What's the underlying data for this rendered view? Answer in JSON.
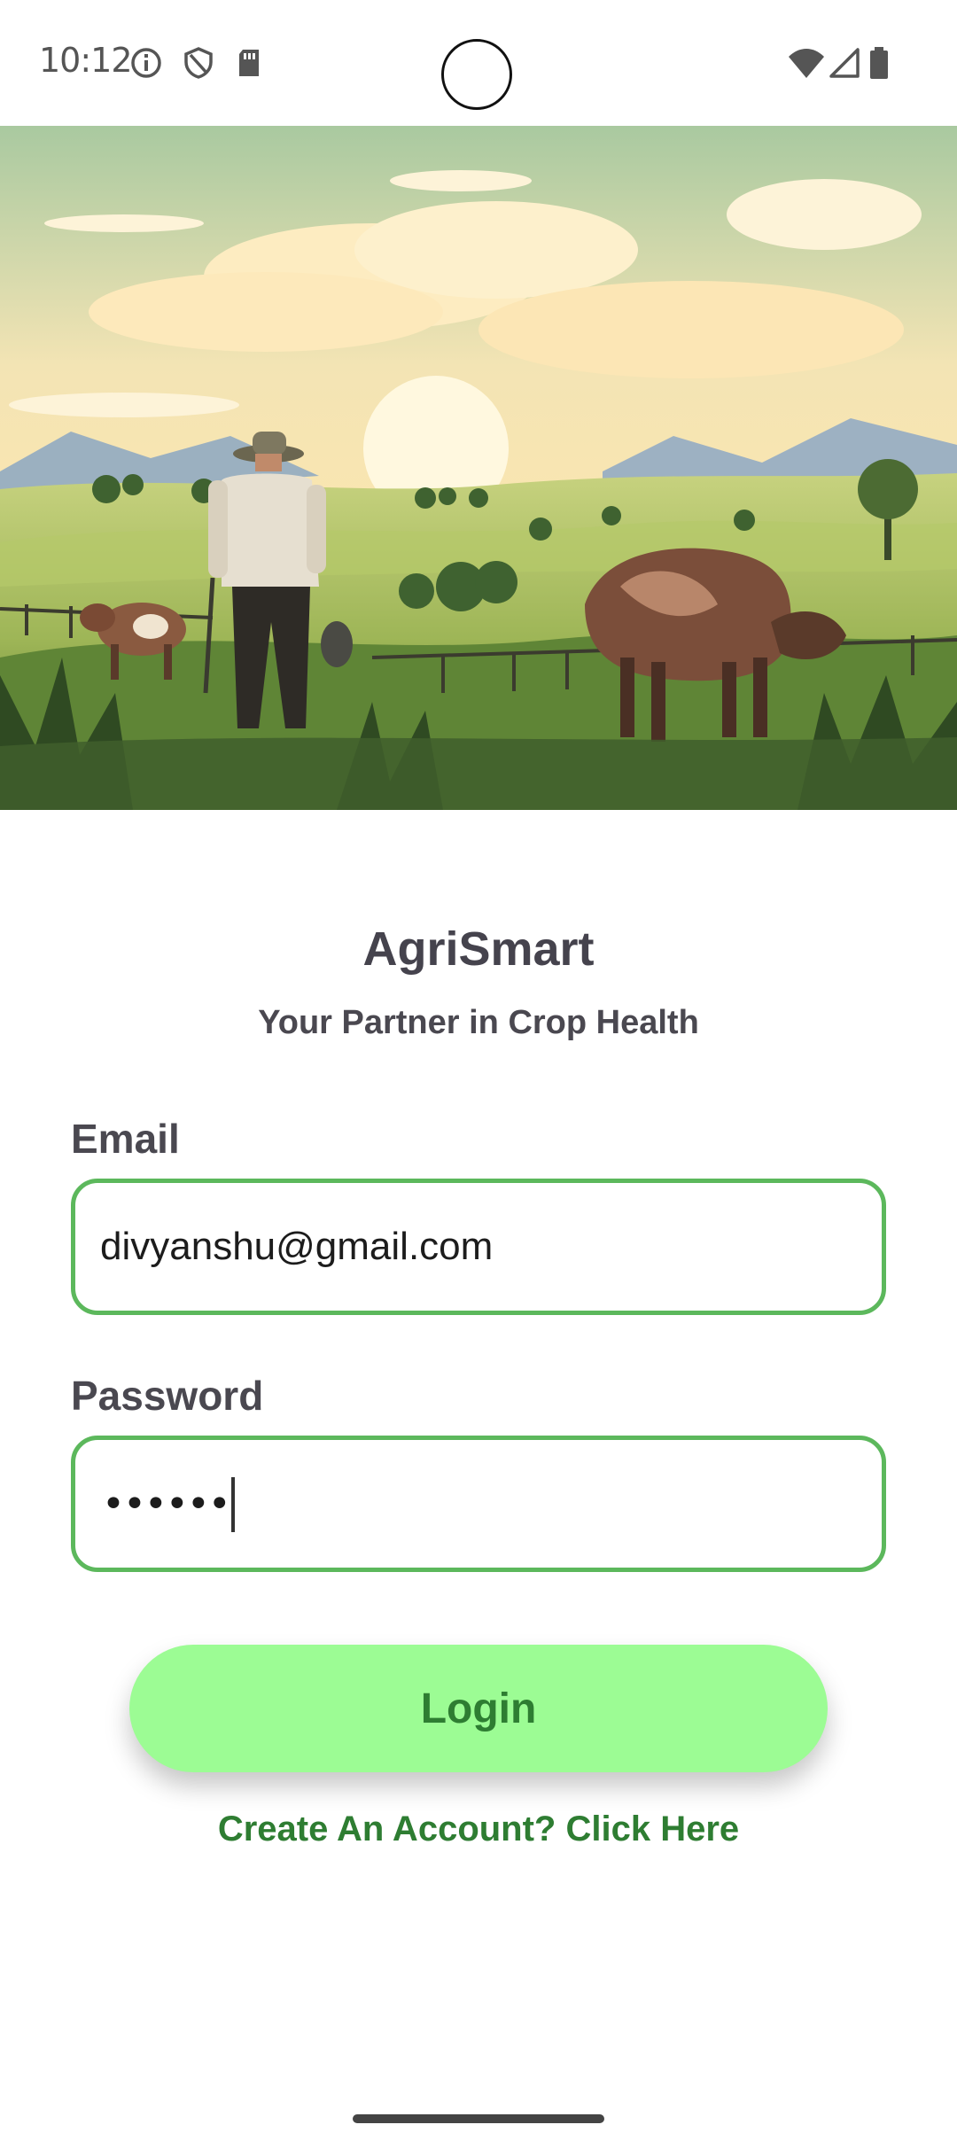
{
  "status_bar": {
    "time": "10:12",
    "icons": [
      "info-icon",
      "shield-icon",
      "sd-card-icon",
      "wifi-icon",
      "signal-icon",
      "battery-icon"
    ]
  },
  "hero": {
    "image": "farmer-with-cows-in-field-illustration"
  },
  "app": {
    "title": "AgriSmart",
    "subtitle": "Your Partner in Crop Health"
  },
  "form": {
    "email_label": "Email",
    "email_value": "divyanshu@gmail.com",
    "password_label": "Password",
    "password_masked": "••••••",
    "login_label": "Login",
    "signup_link": "Create An Account? Click Here"
  },
  "colors": {
    "accent_green": "#2e7d32",
    "field_border": "#5cb85c",
    "button_bg": "#9cfc94",
    "title_text": "#45434d"
  }
}
